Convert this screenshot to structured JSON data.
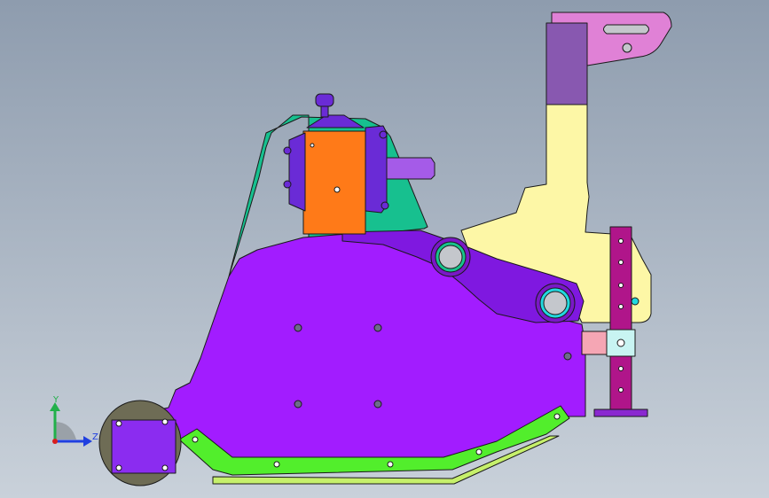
{
  "viewport": {
    "background_top": "#8e9cae",
    "background_bottom": "#c9d1da"
  },
  "triad": {
    "y_label": "Y",
    "z_label": "Z",
    "y_color": "#22b04a",
    "z_color": "#1f3fe0",
    "origin_color": "#d81e1e"
  },
  "colors": {
    "frame_green": "#17c08f",
    "main_housing": "#a21cff",
    "arm": "#7f18e0",
    "gearbox": "#ff7a18",
    "gearbox_cap": "#6a2bd6",
    "bracket_yellow": "#fdf7a6",
    "mount_pink": "#e081d6",
    "mount_post": "#8858b0",
    "jack_magenta": "#b0158a",
    "jack_pink": "#f5a6b4",
    "jack_cyan": "#c8f4f2",
    "skid_green": "#52ee2c",
    "skid_base": "#c6f06b",
    "roller": "#6e6c55",
    "roller_housing": "#8b2cf0",
    "edge": "#1a1a1a"
  }
}
